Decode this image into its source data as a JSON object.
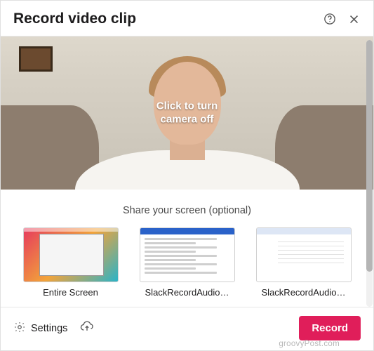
{
  "header": {
    "title": "Record video clip"
  },
  "camera": {
    "overlay_line1": "Click to turn",
    "overlay_line2": "camera off"
  },
  "share": {
    "title": "Share your screen (optional)",
    "options": [
      {
        "label": "Entire Screen"
      },
      {
        "label": "SlackRecordAudio…"
      },
      {
        "label": "SlackRecordAudio…"
      }
    ]
  },
  "footer": {
    "settings_label": "Settings",
    "record_label": "Record"
  },
  "watermark": "groovyPost.com",
  "colors": {
    "accent": "#e01e5a"
  }
}
